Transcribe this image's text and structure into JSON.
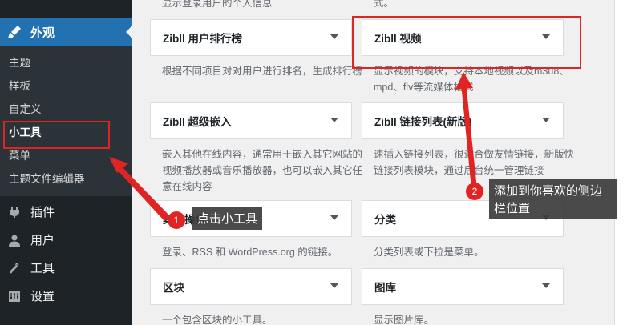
{
  "sidebar": {
    "current": {
      "label": "外观",
      "icon": "paintbrush-icon"
    },
    "submenu": [
      "主题",
      "样板",
      "自定义",
      "小工具",
      "菜单",
      "主题文件编辑器"
    ],
    "menu": [
      {
        "label": "插件",
        "icon": "plugin-icon"
      },
      {
        "label": "用户",
        "icon": "user-icon"
      },
      {
        "label": "工具",
        "icon": "wrench-icon"
      },
      {
        "label": "设置",
        "icon": "settings-icon"
      }
    ]
  },
  "widgets": {
    "top_desc_left": "显示登录用户的个人信息",
    "top_desc_right": "式。",
    "items": [
      {
        "name": "Zibll 用户排行榜",
        "desc": "根据不同项目对对用户进行排名，生成排行榜"
      },
      {
        "name": "Zibll 视频",
        "desc": "显示视频的模块，支持本地视频以及m3u8、mpd、flv等流媒体格式"
      },
      {
        "name": "Zibll 超级嵌入",
        "desc": "嵌入其他在线内容，通常用于嵌入其它网站的视频播放器或音乐播放器，也可以嵌入其它任意在线内容"
      },
      {
        "name": "Zibll 链接列表(新版)",
        "desc": "速插入链接列表，很适合做友情链接，新版快链接列表模块，通过后台统一管理链接"
      },
      {
        "name": "其他操作",
        "desc": "登录、RSS 和 WordPress.org 的链接。"
      },
      {
        "name": "分类",
        "desc": "分类列表或下拉是菜单。"
      },
      {
        "name": "区块",
        "desc": "一个包含区块的小工具。"
      },
      {
        "name": "图库",
        "desc": "显示图片库。"
      }
    ]
  },
  "annotations": {
    "step1": {
      "num": "1",
      "text": "点击小工具"
    },
    "step2": {
      "num": "2",
      "text1": "添加到你喜欢的侧边",
      "text2": "栏位置"
    }
  },
  "colors": {
    "accent": "#2271b1",
    "annotation": "#e02424"
  }
}
